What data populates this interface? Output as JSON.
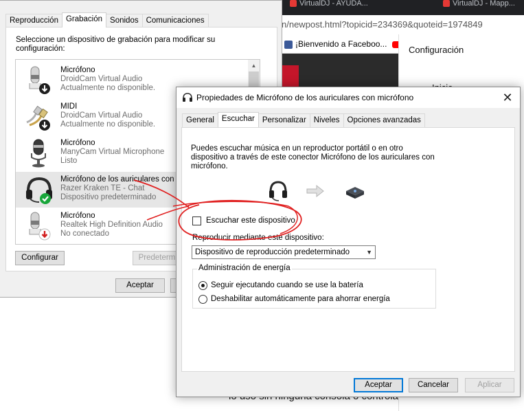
{
  "browser": {
    "tabs": [
      "VirtualDJ - AYUDA...",
      "VirtualDJ - Mapp..."
    ],
    "address": "n/newpost.html?topicid=234369&quoteid=1974849",
    "bookmark": "¡Bienvenido a Faceboo...",
    "config_panel": {
      "title": "Configuración",
      "item": "Inicio"
    },
    "bottom_text": "lo uso sin ninguna consola o controla"
  },
  "sound_dialog": {
    "tabs": [
      "Reproducción",
      "Grabación",
      "Sonidos",
      "Comunicaciones"
    ],
    "active_tab": "Grabación",
    "instructions": "Seleccione un dispositivo de grabación para modificar su configuración:",
    "devices": [
      {
        "name": "Micrófono",
        "driver": "DroidCam Virtual Audio",
        "status": "Actualmente no disponible.",
        "icon": "microphone-icon",
        "badge": "down-arrow"
      },
      {
        "name": "MIDI",
        "driver": "DroidCam Virtual Audio",
        "status": "Actualmente no disponible.",
        "icon": "rca-cable-icon",
        "badge": "down-arrow"
      },
      {
        "name": "Micrófono",
        "driver": "ManyCam Virtual Microphone",
        "status": "Listo",
        "icon": "microphone-icon",
        "badge": "none"
      },
      {
        "name": "Micrófono de los auriculares con micrófono",
        "driver": "Razer Kraken TE - Chat",
        "status": "Dispositivo predeterminado",
        "icon": "headset-icon",
        "badge": "green-check",
        "selected": true
      },
      {
        "name": "Micrófono",
        "driver": "Realtek High Definition Audio",
        "status": "No conectado",
        "icon": "microphone-icon",
        "badge": "red-down-arrow"
      }
    ],
    "configure_label": "Configurar",
    "default_label": "Predeterminar",
    "accept_label": "Aceptar"
  },
  "props_dialog": {
    "title": "Propiedades de Micrófono de los auriculares con micrófono",
    "tabs": [
      "General",
      "Escuchar",
      "Personalizar",
      "Niveles",
      "Opciones avanzadas"
    ],
    "active_tab": "Escuchar",
    "description": "Puedes escuchar música en un reproductor portátil o en otro dispositivo a través de este conector Micrófono de los auriculares con micrófono.",
    "listen_checkbox": {
      "label": "Escuchar este dispositivo",
      "checked": false
    },
    "playback_label": "Reproducir mediante este dispositivo:",
    "playback_value": "Dispositivo de reproducción predeterminado",
    "power": {
      "title": "Administración de energía",
      "option1": "Seguir ejecutando cuando se use la batería",
      "option2": "Deshabilitar automáticamente para ahorrar energía",
      "selected": 1
    },
    "buttons": {
      "ok": "Aceptar",
      "cancel": "Cancelar",
      "apply": "Aplicar"
    }
  },
  "colors": {
    "accent": "#0078d7",
    "annotation": "#e02020",
    "check_green": "#16a34a"
  }
}
